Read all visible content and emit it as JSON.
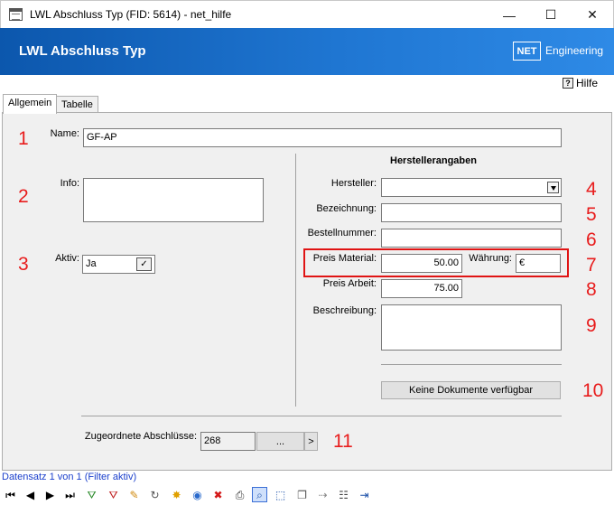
{
  "window": {
    "title": "LWL Abschluss Typ (FID: 5614) - net_hilfe",
    "minimize": "—",
    "maximize": "☐",
    "close": "✕"
  },
  "banner": {
    "title": "LWL Abschluss Typ",
    "logo_box": "NET",
    "logo_text": "Engineering"
  },
  "help": {
    "label": "Hilfe"
  },
  "tabs": [
    {
      "label": "Allgemein",
      "active": true
    },
    {
      "label": "Tabelle",
      "active": false
    }
  ],
  "form": {
    "name_label": "Name:",
    "name_value": "GF-AP",
    "info_label": "Info:",
    "info_value": "",
    "aktiv_label": "Aktiv:",
    "aktiv_value": "Ja",
    "aktiv_check": "✓",
    "hersteller_heading": "Herstellerangaben",
    "hersteller_label": "Hersteller:",
    "hersteller_value": "",
    "bezeichnung_label": "Bezeichnung:",
    "bezeichnung_value": "",
    "bestellnummer_label": "Bestellnummer:",
    "bestellnummer_value": "",
    "preis_material_label": "Preis Material:",
    "preis_material_value": "50.00",
    "waehrung_label": "Währung:",
    "waehrung_value": "€",
    "preis_arbeit_label": "Preis Arbeit:",
    "preis_arbeit_value": "75.00",
    "beschreibung_label": "Beschreibung:",
    "beschreibung_value": "",
    "dokumente_button": "Keine Dokumente verfügbar",
    "abschluesse_label": "Zugeordnete Abschlüsse:",
    "abschluesse_value": "268",
    "abschluesse_browse": "...",
    "abschluesse_go": ">"
  },
  "markers": [
    "1",
    "2",
    "3",
    "4",
    "5",
    "6",
    "7",
    "8",
    "9",
    "10",
    "11"
  ],
  "status": {
    "text": "Datensatz 1 von 1 (Filter aktiv)"
  },
  "toolbar": {
    "first": "⏮",
    "prev": "◀",
    "next": "▶",
    "last": "⏭",
    "filter_add": "⛛",
    "filter_remove": "⛛",
    "edit": "✎",
    "refresh": "↻",
    "new": "✸",
    "web": "◉",
    "delete": "✖",
    "print": "⎙",
    "zoom": "⌕",
    "select": "⬚",
    "copy": "❐",
    "split": "⇢",
    "table": "☷",
    "exit": "⇥"
  },
  "colors": {
    "banner_start": "#0c57ad",
    "banner_end": "#2e8ae6",
    "marker_red": "#e81c1c",
    "status_blue": "#1a3fcc"
  }
}
